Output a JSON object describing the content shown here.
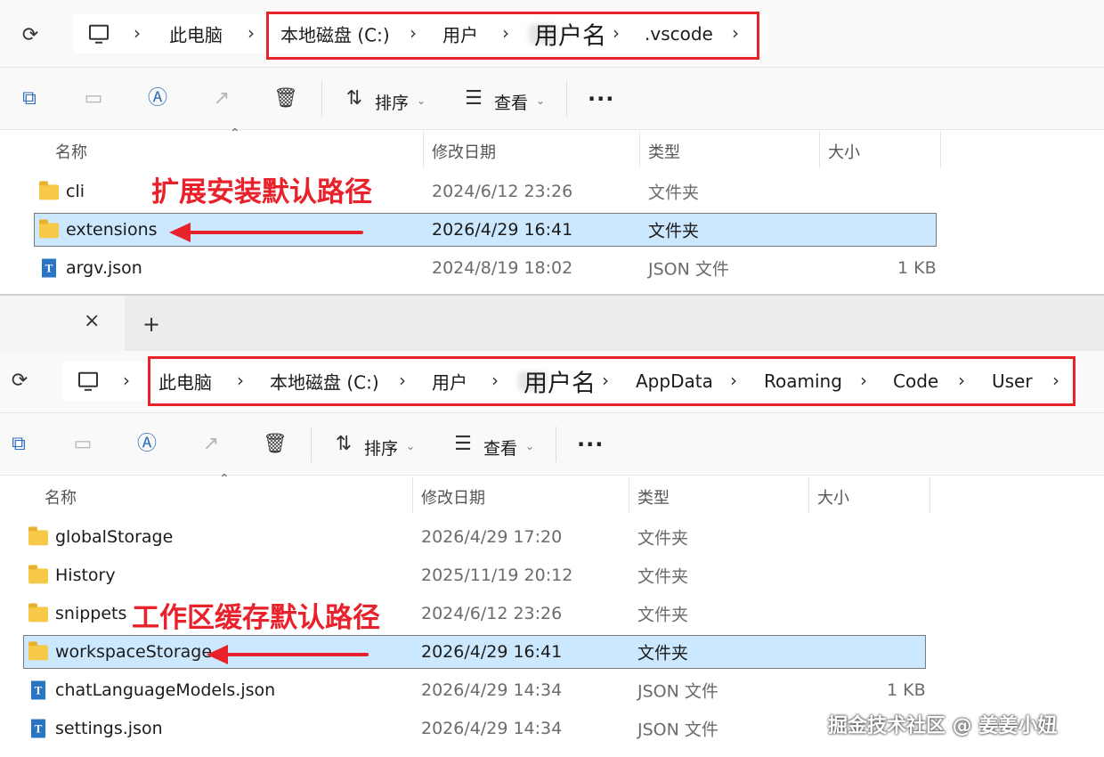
{
  "window1": {
    "breadcrumb": [
      "此电脑",
      "本地磁盘 (C:)",
      "用户",
      "用户名",
      ".vscode"
    ],
    "toolbar": {
      "sort_label": "排序",
      "view_label": "查看",
      "more_label": "···"
    },
    "columns": [
      "名称",
      "修改日期",
      "类型",
      "大小"
    ],
    "rows": [
      {
        "name": "cli",
        "date": "2024/6/12 23:26",
        "type": "文件夹",
        "size": ""
      },
      {
        "name": "extensions",
        "date": "2026/4/29 16:41",
        "type": "文件夹",
        "size": ""
      },
      {
        "name": "argv.json",
        "date": "2024/8/19 18:02",
        "type": "JSON 文件",
        "size": "1 KB"
      }
    ],
    "annotation": "扩展安装默认路径"
  },
  "tab": {
    "close_label": "×",
    "new_label": "+"
  },
  "window2": {
    "breadcrumb": [
      "此电脑",
      "本地磁盘 (C:)",
      "用户",
      "用户名",
      "AppData",
      "Roaming",
      "Code",
      "User"
    ],
    "toolbar": {
      "sort_label": "排序",
      "view_label": "查看",
      "more_label": "···"
    },
    "columns": [
      "名称",
      "修改日期",
      "类型",
      "大小"
    ],
    "rows": [
      {
        "name": "globalStorage",
        "date": "2026/4/29 17:20",
        "type": "文件夹",
        "size": ""
      },
      {
        "name": "History",
        "date": "2025/11/19 20:12",
        "type": "文件夹",
        "size": ""
      },
      {
        "name": "snippets",
        "date": "2024/6/12 23:26",
        "type": "文件夹",
        "size": ""
      },
      {
        "name": "workspaceStorage",
        "date": "2026/4/29 16:41",
        "type": "文件夹",
        "size": ""
      },
      {
        "name": "chatLanguageModels.json",
        "date": "2026/4/29 14:34",
        "type": "JSON 文件",
        "size": "1 KB"
      },
      {
        "name": "settings.json",
        "date": "2026/4/29 14:34",
        "type": "JSON 文件",
        "size": ""
      }
    ],
    "annotation": "工作区缓存默认路径"
  },
  "watermark": "掘金技术社区 @ 姜姜小妞",
  "colors": {
    "highlight": "#e8212b",
    "selection": "#cce8ff",
    "folder": "#f7c948",
    "json_icon": "#2a74c6"
  },
  "icons": [
    "refresh-icon",
    "computer-icon",
    "copy-icon",
    "paste-icon",
    "rename-icon",
    "share-icon",
    "delete-icon",
    "sort-icon",
    "view-icon",
    "folder-icon",
    "json-file-icon",
    "close-icon",
    "plus-icon"
  ]
}
